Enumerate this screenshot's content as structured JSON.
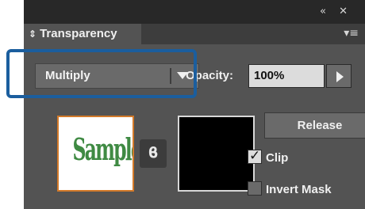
{
  "panel": {
    "tab_arrows": "⇕",
    "tab_label": "Transparency",
    "collapse_glyph": "«",
    "close_glyph": "✕",
    "menu_glyph": "▾≡"
  },
  "blend_mode": {
    "selected": "Multiply"
  },
  "opacity": {
    "label": "Opacity:",
    "value": "100%"
  },
  "thumbnail": {
    "text": "Sample",
    "text_color": "#3f8a43",
    "border_color": "#d37a2a"
  },
  "link_icon_glyph": "ϐ",
  "release_button": "Release",
  "clip": {
    "label": "Clip",
    "checked": true
  },
  "invert_mask": {
    "label": "Invert Mask",
    "checked": false
  },
  "colors": {
    "panel_bg": "#535353",
    "highlight": "#1b5e9e"
  }
}
